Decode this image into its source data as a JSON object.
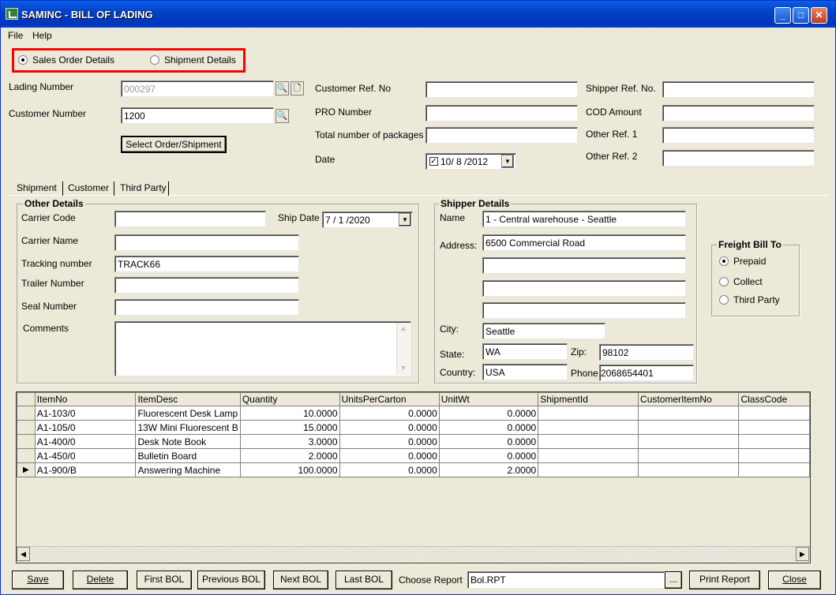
{
  "window": {
    "title": "SAMINC - BILL OF LADING",
    "min_glyph": "_",
    "max_glyph": "□",
    "close_glyph": "✕"
  },
  "menu": {
    "file": "File",
    "help": "Help"
  },
  "mode": {
    "sales_order": "Sales Order Details",
    "shipment": "Shipment Details",
    "selected": "sales_order"
  },
  "header": {
    "lading_number_label": "Lading Number",
    "lading_number_value": "000297",
    "customer_number_label": "Customer Number",
    "customer_number_value": "1200",
    "select_button": "Select Order/Shipment",
    "customer_ref_label": "Customer Ref. No",
    "customer_ref_value": "",
    "pro_number_label": "PRO Number",
    "pro_number_value": "",
    "total_packages_label": "Total number of packages",
    "total_packages_value": "",
    "date_label": "Date",
    "date_value": "10/ 8 /2012",
    "shipper_ref_label": "Shipper Ref. No.",
    "shipper_ref_value": "",
    "cod_label": "COD Amount",
    "cod_value": "",
    "other_ref1_label": "Other Ref. 1",
    "other_ref1_value": "",
    "other_ref2_label": "Other Ref. 2",
    "other_ref2_value": ""
  },
  "tabs": [
    "Shipment",
    "Customer",
    "Third Party"
  ],
  "other_details": {
    "title": "Other Details",
    "carrier_code_label": "Carrier Code",
    "carrier_code_value": "",
    "ship_date_label": "Ship Date",
    "ship_date_value": "7 / 1 /2020",
    "carrier_name_label": "Carrier Name",
    "carrier_name_value": "",
    "tracking_label": "Tracking number",
    "tracking_value": "TRACK66",
    "trailer_label": "Trailer Number",
    "trailer_value": "",
    "seal_label": "Seal Number",
    "seal_value": "",
    "comments_label": "Comments",
    "comments_value": ""
  },
  "shipper": {
    "title": "Shipper  Details",
    "name_label": "Name",
    "name_value": "1 - Central warehouse - Seattle",
    "address_label": "Address:",
    "address1": "6500 Commercial Road",
    "address2": "",
    "address3": "",
    "address4": "",
    "city_label": "City:",
    "city_value": "Seattle",
    "state_label": "State:",
    "state_value": "WA",
    "zip_label": "Zip:",
    "zip_value": "98102",
    "country_label": "Country:",
    "country_value": "USA",
    "phone_label": "Phone",
    "phone_value": "2068654401"
  },
  "freight": {
    "title": "Freight Bill To",
    "options": [
      "Prepaid",
      "Collect",
      "Third Party"
    ],
    "selected": 0
  },
  "grid": {
    "columns": [
      "ItemNo",
      "ItemDesc",
      "Quantity",
      "UnitsPerCarton",
      "UnitWt",
      "ShipmentId",
      "CustomerItemNo",
      "ClassCode"
    ],
    "rows": [
      [
        "A1-103/0",
        "Fluorescent Desk Lamp",
        "10.0000",
        "0.0000",
        "0.0000",
        "",
        "",
        ""
      ],
      [
        "A1-105/0",
        "13W Mini Fluorescent B",
        "15.0000",
        "0.0000",
        "0.0000",
        "",
        "",
        ""
      ],
      [
        "A1-400/0",
        "Desk Note Book",
        "3.0000",
        "0.0000",
        "0.0000",
        "",
        "",
        ""
      ],
      [
        "A1-450/0",
        "Bulletin Board",
        "2.0000",
        "0.0000",
        "0.0000",
        "",
        "",
        ""
      ],
      [
        "A1-900/B",
        "Answering Machine",
        "100.0000",
        "0.0000",
        "2.0000",
        "",
        "",
        ""
      ]
    ],
    "current_row": 4
  },
  "footer": {
    "save": "Save",
    "delete": "Delete",
    "first": "First BOL",
    "previous": "Previous BOL",
    "next": "Next BOL",
    "last": "Last BOL",
    "choose_report_label": "Choose Report",
    "report_value": "Bol.RPT",
    "browse": "...",
    "print": "Print Report",
    "close": "Close"
  }
}
